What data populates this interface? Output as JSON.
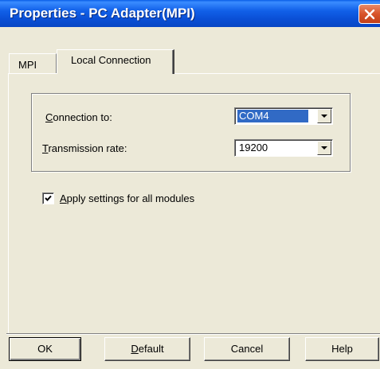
{
  "window": {
    "title": "Properties - PC Adapter(MPI)"
  },
  "tabs": [
    {
      "label": "MPI",
      "selected": false
    },
    {
      "label": "Local Connection",
      "selected": true
    }
  ],
  "connection": {
    "label_access": "C",
    "label_rest": "onnection to:",
    "value": "COM4"
  },
  "transmission": {
    "label_access": "T",
    "label_rest": "ransmission rate:",
    "value": "19200"
  },
  "apply_all": {
    "checked": true,
    "label_access": "A",
    "label_rest": "pply settings for all modules"
  },
  "buttons": {
    "ok": "OK",
    "default_access": "D",
    "default_rest": "efault",
    "cancel": "Cancel",
    "help": "Help"
  },
  "colors": {
    "titlebar": "#0a5ee8",
    "selection": "#316ac5",
    "face": "#ece9d8",
    "close": "#d8542a"
  }
}
